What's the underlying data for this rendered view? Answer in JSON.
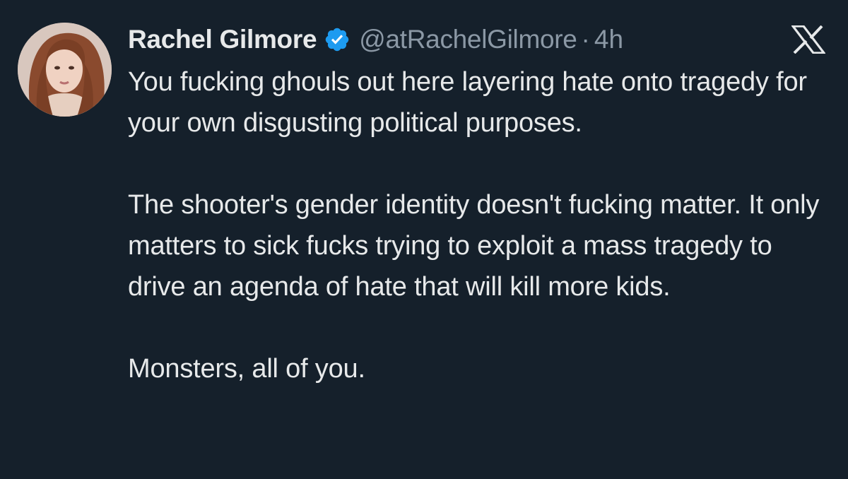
{
  "author": {
    "name": "Rachel Gilmore",
    "handle": "@atRachelGilmore",
    "separator": "·",
    "time": "4h",
    "verified_icon": "verified-badge-icon",
    "verified_color": "#1d9bf0"
  },
  "platform": {
    "logo_icon": "x-logo-icon"
  },
  "tweet": {
    "paragraphs": [
      "You fucking ghouls out here layering hate onto tragedy for your own disgusting political purposes.",
      "The shooter's gender identity doesn't fucking matter. It only matters to sick fucks trying to exploit a mass tragedy to drive an agenda of hate that will kill more kids.",
      "Monsters, all of you."
    ]
  },
  "theme": {
    "background": "#15202b",
    "text": "#e7e9ea",
    "secondary_text": "#8b98a5"
  }
}
